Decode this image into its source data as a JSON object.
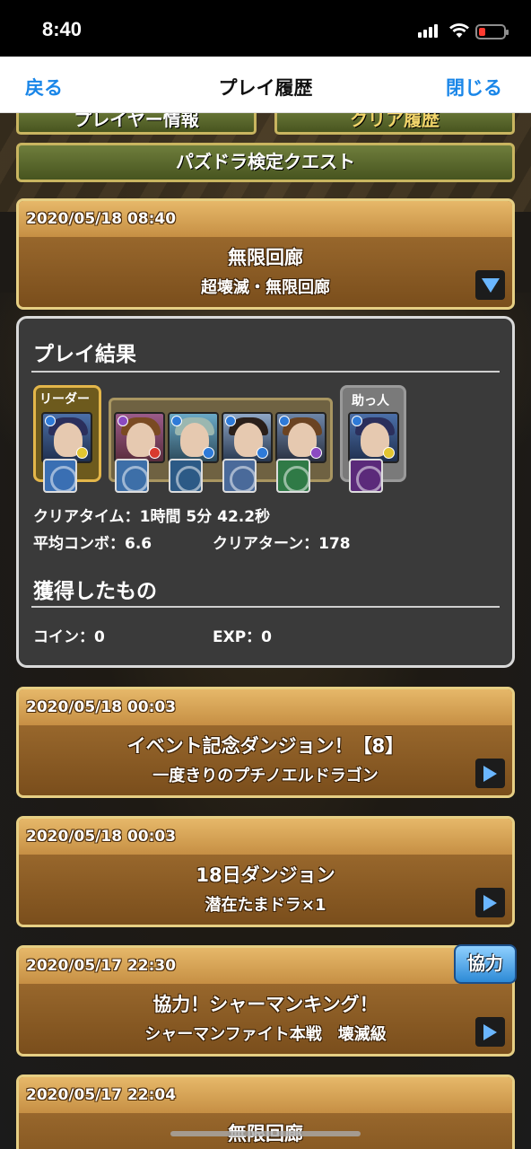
{
  "status": {
    "time": "8:40"
  },
  "nav": {
    "back": "戻る",
    "title": "プレイ履歴",
    "close": "閉じる"
  },
  "tabs": {
    "left": "プレイヤー情報",
    "right": "クリア履歴"
  },
  "quest_button": "パズドラ検定クエスト",
  "history": [
    {
      "date": "2020/05/18 08:40",
      "name": "無限回廊",
      "sub": "超壊滅・無限回廊",
      "expanded": true
    },
    {
      "date": "2020/05/18 00:03",
      "name": "イベント記念ダンジョン！【8】",
      "sub": "一度きりのプチノエルドラゴン",
      "expanded": false
    },
    {
      "date": "2020/05/18 00:03",
      "name": "18日ダンジョン",
      "sub": "潜在たまドラ×1",
      "expanded": false
    },
    {
      "date": "2020/05/17 22:30",
      "name": "協力！シャーマンキング！",
      "sub": "シャーマンファイト本戦　壊滅級",
      "expanded": false,
      "badge": "協力"
    },
    {
      "date": "2020/05/17 22:04",
      "name": "無限回廊",
      "sub": "",
      "expanded": false
    }
  ],
  "result": {
    "title": "プレイ結果",
    "leader_label": "リーダー",
    "helper_label": "助っ人",
    "clear_time": "クリアタイム：1時間 5分 42.2秒",
    "avg_combo": "平均コンボ：6.6",
    "clear_turn": "クリアターン：178",
    "obtained_title": "獲得したもの",
    "coin": "コイン：0",
    "exp": "EXP：0"
  }
}
